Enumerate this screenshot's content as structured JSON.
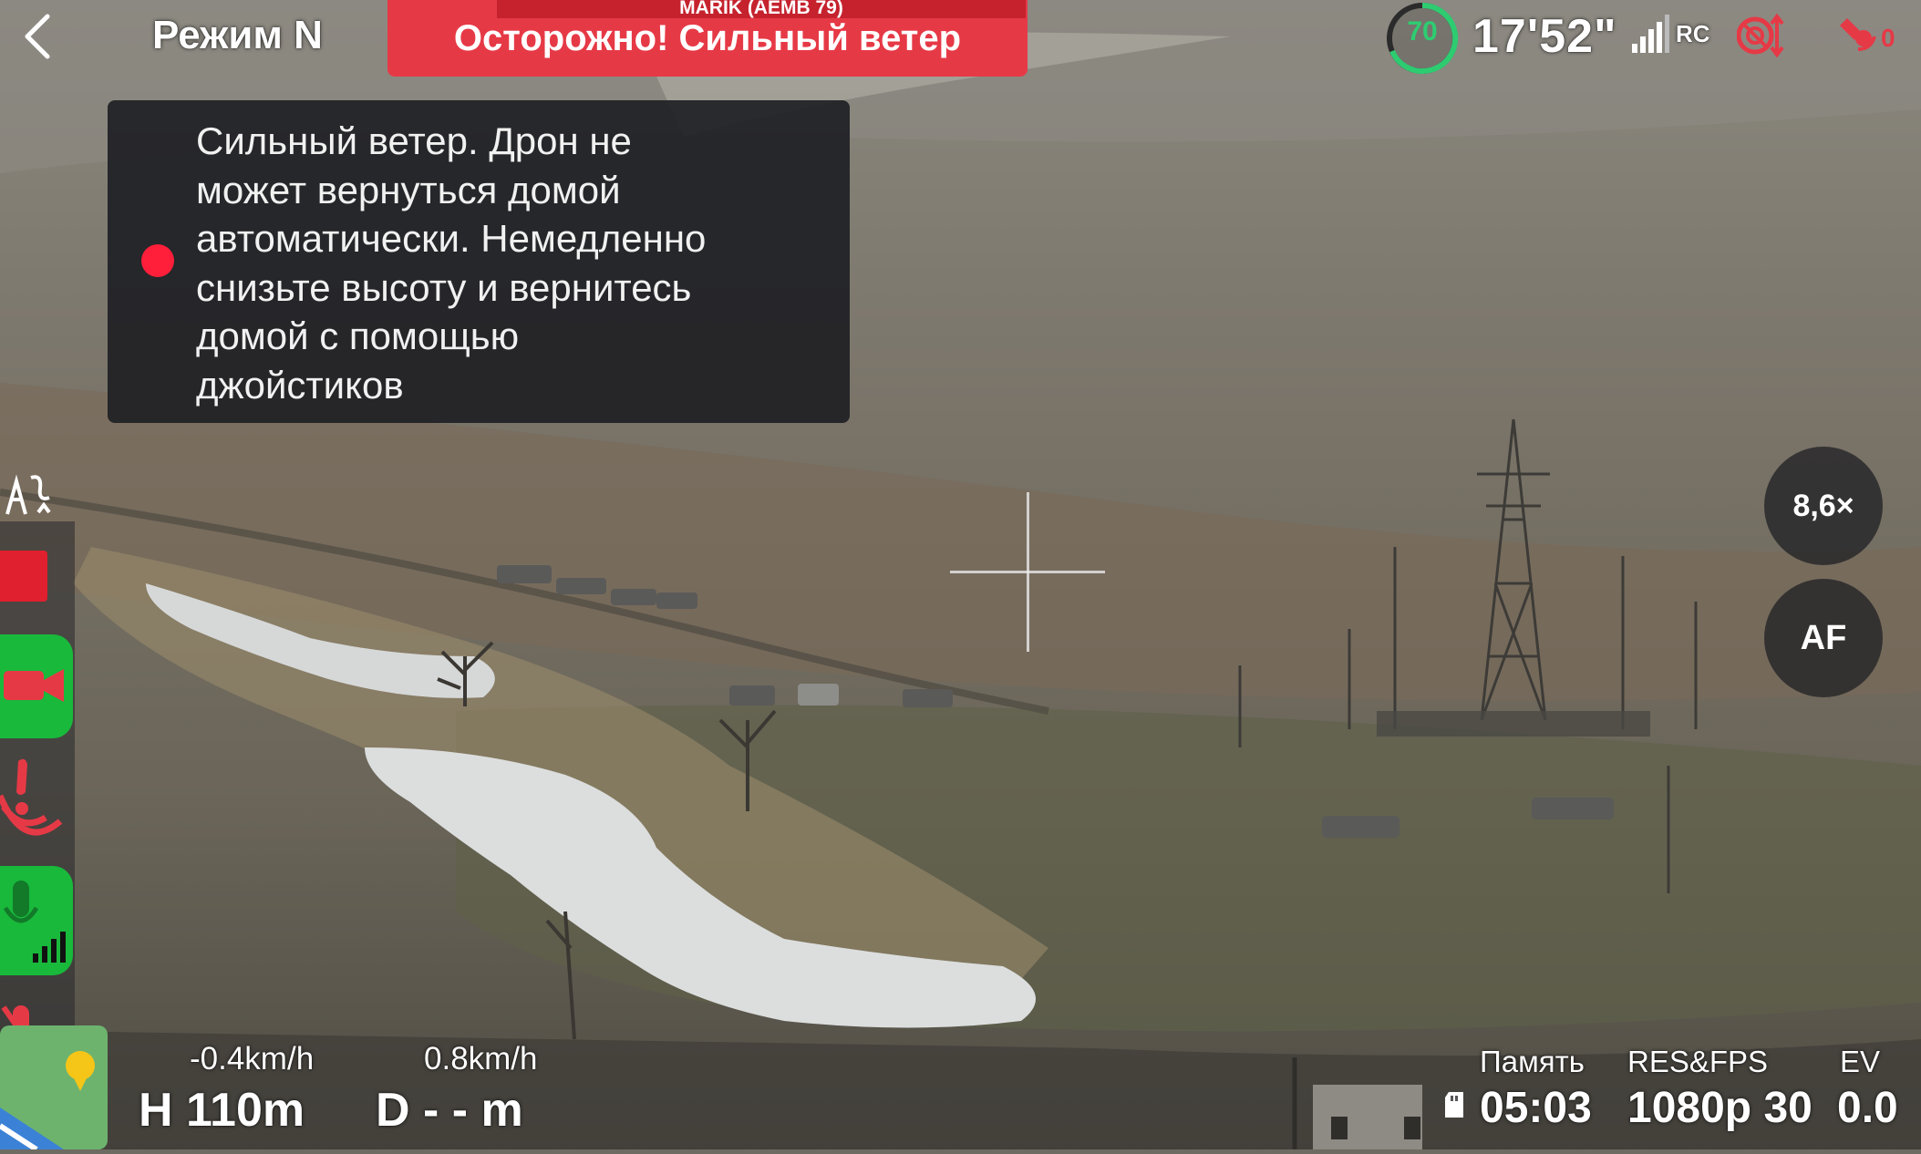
{
  "top_bar": {
    "mode": "Режим N",
    "warning": "Осторожно! Сильный ветер",
    "pilot": "MARIK (AEMB 79)",
    "battery_percent": "70",
    "flight_time_left": "17'52\"",
    "rc_label": "RC",
    "gps_satellites": "0"
  },
  "alert": {
    "lines": [
      "Сильный ветер. Дрон не",
      "может вернуться домой",
      "автоматически. Немедленно",
      "снизьте высоту и вернитесь",
      "домой с помощью",
      "джойстиков"
    ]
  },
  "camera": {
    "zoom": "8,6×",
    "focus": "AF"
  },
  "telemetry": {
    "vertical_speed": "-0.4km/h",
    "horizontal_speed": "0.8km/h",
    "height": "H 110m",
    "distance": "D - - m"
  },
  "recording": {
    "storage_label": "Память",
    "storage_value": "05:03",
    "resfps_label": "RES&FPS",
    "resfps_value": "1080p 30",
    "ev_label": "EV",
    "ev_value": "0.0"
  },
  "colors": {
    "warning_red": "#e63946",
    "alert_dot": "#ff1f3a",
    "action_green": "#19b93c",
    "battery_green": "#2ecc71"
  },
  "icons": [
    "back-icon",
    "signal-icon",
    "obstacle-avoidance-icon",
    "gps-icon",
    "track-icon",
    "video-icon",
    "speaker-icon",
    "mic-icon",
    "mic-mute-icon",
    "map-icon",
    "sd-card-icon"
  ]
}
